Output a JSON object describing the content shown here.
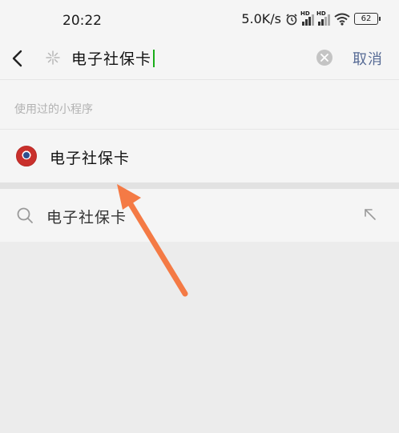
{
  "status_bar": {
    "time": "20:22",
    "net_speed": "5.0K/s",
    "signal_badge": "HD",
    "battery": "62"
  },
  "search": {
    "query": "电子社保卡",
    "cancel_label": "取消"
  },
  "history": {
    "header": "使用过的小程序",
    "items": [
      {
        "label": "电子社保卡"
      }
    ]
  },
  "suggestions": [
    {
      "label": "电子社保卡"
    }
  ],
  "colors": {
    "accent_link": "#576b95",
    "caret": "#1aad19",
    "annotation_arrow": "#f47a45"
  }
}
